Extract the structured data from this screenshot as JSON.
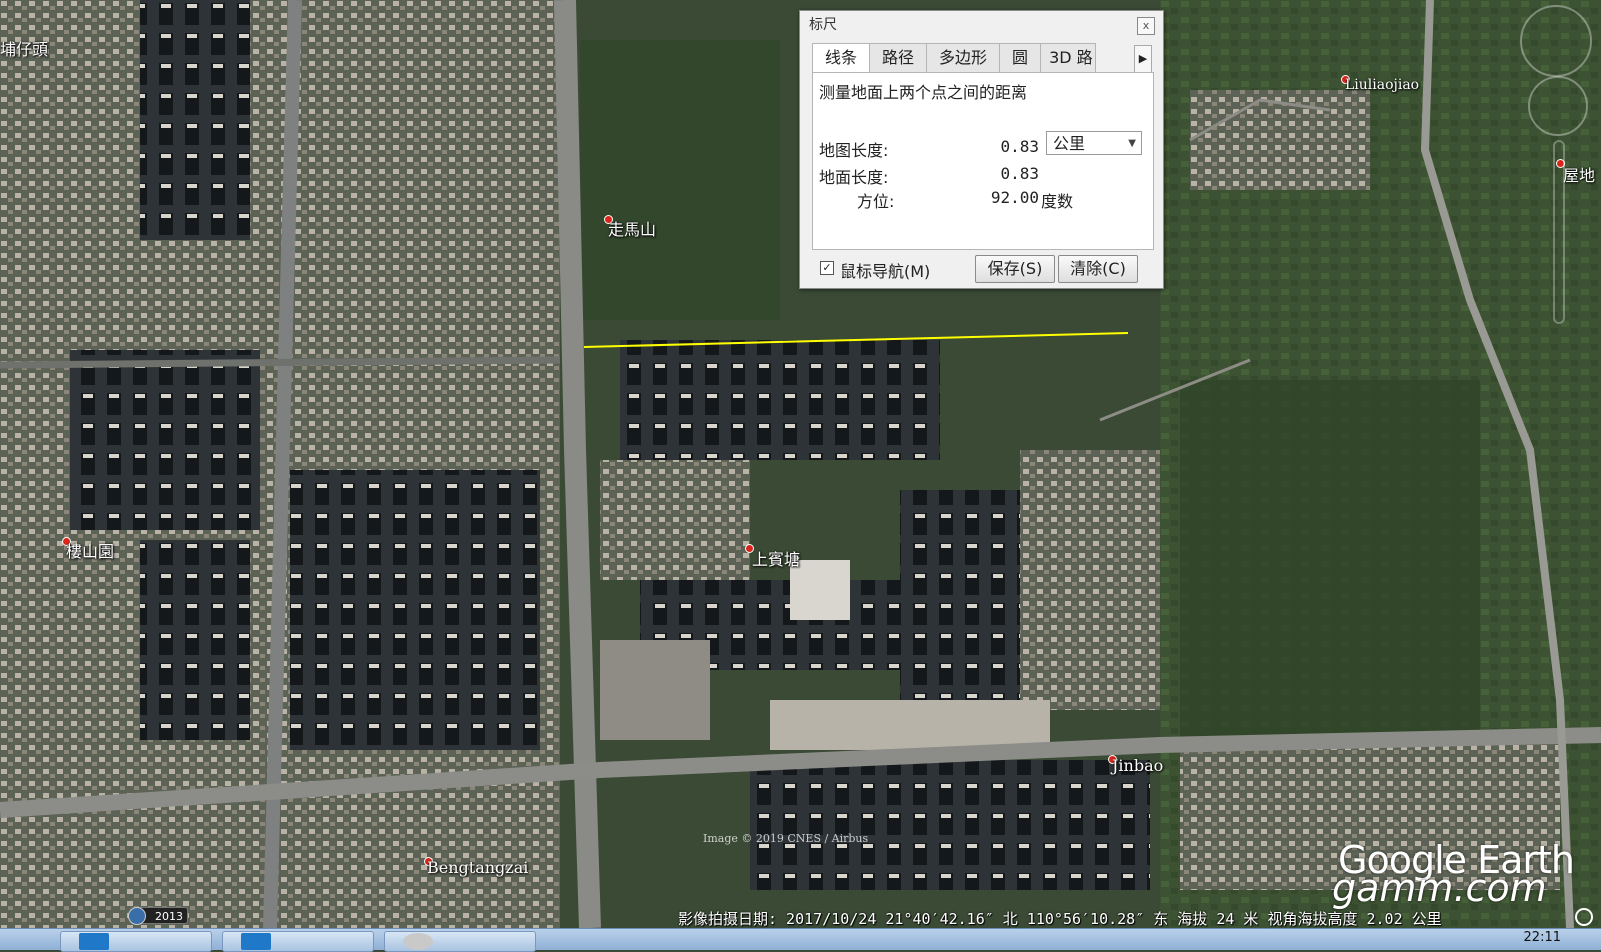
{
  "map": {
    "places": [
      {
        "name": "走馬山"
      },
      {
        "name": "Liuliaojiao"
      },
      {
        "name": "屋地"
      },
      {
        "name": "上賓塘"
      },
      {
        "name": "Jinbao"
      },
      {
        "name": "Bengtangzai"
      },
      {
        "name": "埔仔頭"
      },
      {
        "name": "樓山園"
      }
    ],
    "attribution": "Image © 2019 CNES / Airbus",
    "logo_text": "Google Earth",
    "watermark": "gamm.com",
    "history_year": "2013",
    "measure_line_color": "#ffff00"
  },
  "ruler": {
    "title": "标尺",
    "close_label": "x",
    "tabs": [
      "线条",
      "路径",
      "多边形",
      "圆",
      "3D 路"
    ],
    "active_tab": "线条",
    "next_tab_label": "▶",
    "description": "测量地面上两个点之间的距离",
    "map_length_label": "地图长度:",
    "map_length_value": "0.83",
    "unit": "公里",
    "ground_length_label": "地面长度:",
    "ground_length_value": "0.83",
    "heading_label": "方位:",
    "heading_value": "92.00",
    "heading_unit": "度数",
    "mouse_nav_label": "鼠标导航(M)",
    "mouse_nav_checked": "✓",
    "save_label": "保存(S)",
    "clear_label": "清除(C)"
  },
  "status": {
    "text": "影像拍摄日期: 2017/10/24   21°40′42.16″ 北 110°56′10.28″ 东 海拔   24 米   视角海拔高度   2.02 公里"
  },
  "taskbar": {
    "clock": "22:11"
  }
}
